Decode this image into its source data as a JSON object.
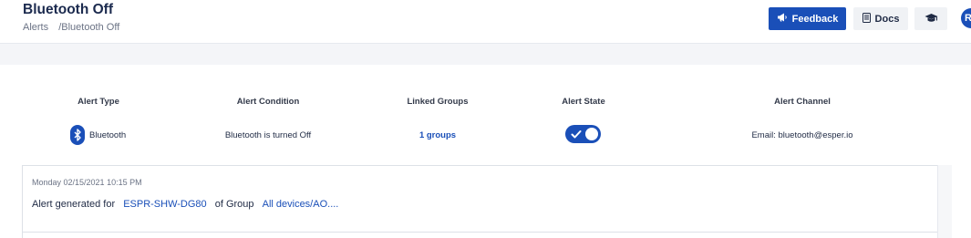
{
  "header": {
    "title": "Bluetooth Off",
    "breadcrumb": {
      "root": "Alerts",
      "separator": "/",
      "current": "Bluetooth Off"
    },
    "buttons": {
      "feedback": "Feedback",
      "docs": "Docs"
    },
    "avatar_initial": "R"
  },
  "alert": {
    "columns": {
      "type": "Alert Type",
      "condition": "Alert Condition",
      "groups": "Linked Groups",
      "state": "Alert State",
      "channel": "Alert Channel"
    },
    "values": {
      "type": "Bluetooth",
      "condition": "Bluetooth is turned Off",
      "groups": "1 groups",
      "state_on": true,
      "channel": "Email: bluetooth@esper.io"
    }
  },
  "log": {
    "timestamp": "Monday 02/15/2021 10:15 PM",
    "prefix": "Alert generated for",
    "device": "ESPR-SHW-DG80",
    "middle": "of Group",
    "group": "All devices/AO...."
  },
  "colors": {
    "accent": "#1a4fb8",
    "band": "#f4f5f8"
  }
}
